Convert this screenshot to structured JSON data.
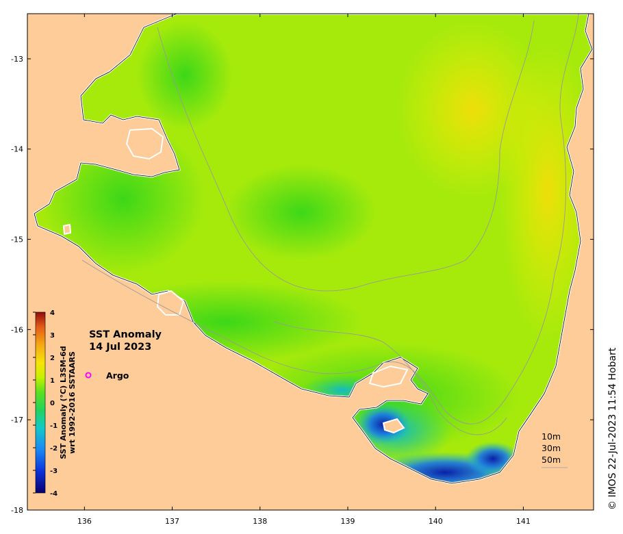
{
  "map": {
    "title_line1": "SST Anomaly",
    "title_line2": "14 Jul 2023",
    "legend_argo": "Argo",
    "credit": "© IMOS 22-Jul-2023 11:54 Hobart",
    "contours": [
      "10m",
      "30m",
      "50m"
    ],
    "colorbar_label_line1": "SST Anomaly (°C) L3SM-6d",
    "colorbar_label_line2": "wrt 1992-2016 SSTAARS",
    "colorbar_ticks": [
      "4",
      "3",
      "2",
      "1",
      "0",
      "-1",
      "-2",
      "-3",
      "-4"
    ],
    "colors": {
      "land": "#fdcc99",
      "argo_marker": "#ff00ff",
      "colormap": [
        "#08006e",
        "#0b33d9",
        "#1a88f4",
        "#12c9c8",
        "#22d35a",
        "#5fe01f",
        "#c7f000",
        "#f6e30a",
        "#f6a814",
        "#e25a18",
        "#8f0d0d"
      ]
    }
  },
  "chart_data": {
    "type": "map",
    "title": "SST Anomaly 14 Jul 2023",
    "x_ticks": [
      "136",
      "137",
      "138",
      "139",
      "140",
      "141"
    ],
    "y_ticks": [
      "-13",
      "-14",
      "-15",
      "-16",
      "-17",
      "-18"
    ],
    "xlim": [
      135.35,
      141.8
    ],
    "ylim": [
      -18,
      -12.5
    ],
    "colorbar_range": [
      -4,
      4
    ]
  }
}
